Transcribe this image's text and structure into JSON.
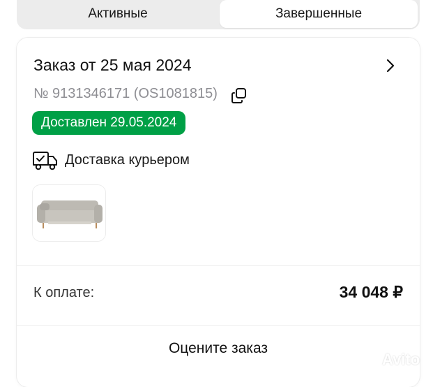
{
  "tabs": [
    {
      "label": "Активные",
      "selected": false
    },
    {
      "label": "Завершенные",
      "selected": true
    }
  ],
  "order": {
    "title": "Заказ от 25 мая 2024",
    "number": "№ 9131346171 (OS1081815)",
    "status": "Доставлен 29.05.2024",
    "status_color": "#00a046",
    "delivery_method": "Доставка курьером",
    "delivery_icon": "truck-check-icon",
    "product_image": "grey-sofa",
    "pay_label": "К оплате:",
    "pay_amount": "34 048 ₽",
    "rate_label": "Оцените заказ"
  },
  "watermark": {
    "text": "Avito"
  }
}
